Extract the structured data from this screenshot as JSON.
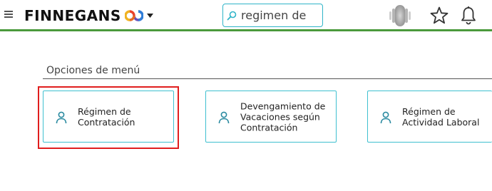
{
  "header": {
    "menu_icon": "hamburger-icon",
    "brand_name": "FINNEGANS",
    "brand_logo": "infinity-logo",
    "brand_dropdown_icon": "caret-down-icon",
    "search": {
      "value": "regimen de",
      "icon": "search-icon"
    },
    "avatar_icon": "user-avatar",
    "favorites_icon": "star-icon",
    "notifications_icon": "bell-icon",
    "accent_color": "#4a9a3c"
  },
  "menu_options": {
    "title": "Opciones de menú",
    "cards": [
      {
        "label": "Régimen de\nContratación",
        "icon": "user-icon",
        "highlighted": true
      },
      {
        "label": "Devengamiento de\nVacaciones según\nContratación",
        "icon": "user-icon",
        "highlighted": false
      },
      {
        "label": "Régimen de\nActividad Laboral",
        "icon": "user-icon",
        "highlighted": false
      }
    ],
    "card_border_color": "#3fc0d0",
    "highlight_color": "#e01e1e"
  }
}
